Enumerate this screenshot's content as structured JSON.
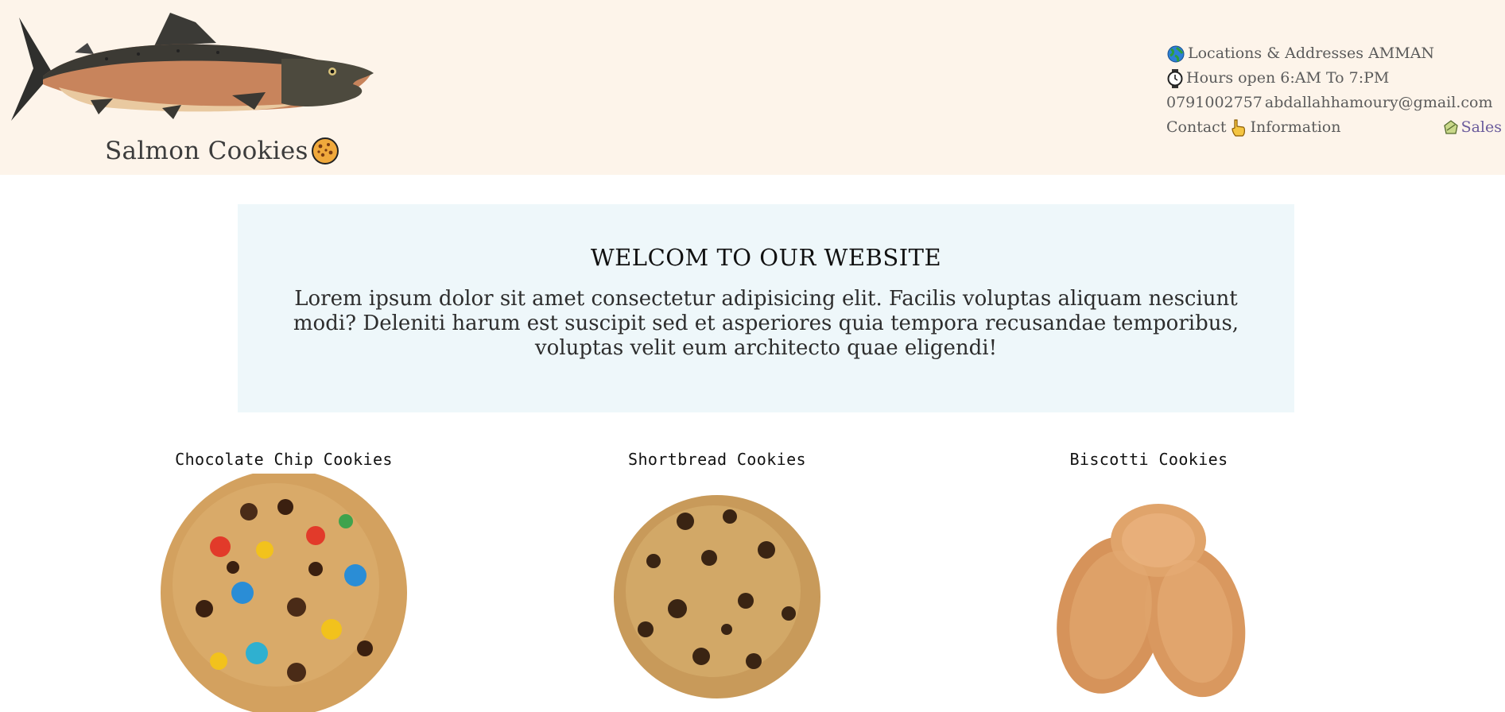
{
  "header": {
    "brand_name": "Salmon Cookies",
    "logo_icon": "salmon-fish-image",
    "brand_icon": "cookie-icon",
    "info": {
      "location_icon": "globe-icon",
      "location_text": "Locations & Addresses AMMAN",
      "hours_icon": "clock-icon",
      "hours_text": "Hours open 6:AM To 7:PM",
      "phone": "0791002757",
      "email": "abdallahhamoury@gmail.com",
      "contact_label": "Contact",
      "contact_icon": "pointing-hand-icon",
      "contact_info_label": "Information",
      "sales_icon": "sales-badge-icon",
      "sales_label": "Sales"
    }
  },
  "welcome": {
    "title": "WELCOM TO OUR WEBSITE",
    "body": "Lorem ipsum dolor sit amet consectetur adipisicing elit. Facilis voluptas aliquam nesciunt modi? Deleniti harum est suscipit sed et asperiores quia tempora recusandae temporibus, voluptas velit eum architecto quae eligendi!"
  },
  "products": [
    {
      "title": "Chocolate Chip Cookies",
      "image": "chocolate-chip-cookie-image"
    },
    {
      "title": "Shortbread Cookies",
      "image": "shortbread-cookie-image"
    },
    {
      "title": "Biscotti Cookies",
      "image": "biscotti-cookies-image"
    }
  ],
  "colors": {
    "header_bg": "#fdf4ea",
    "welcome_bg": "#eef7fa",
    "link": "#6a5b9c"
  }
}
